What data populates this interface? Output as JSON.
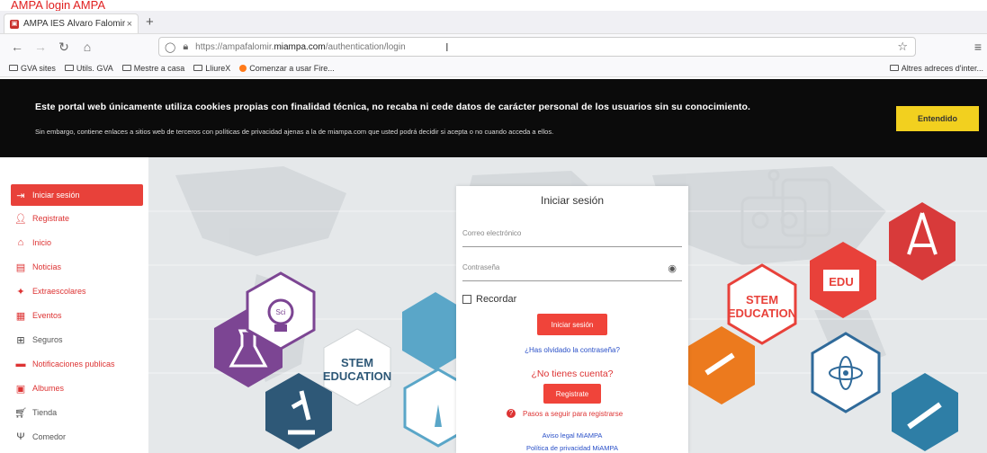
{
  "note": "AMPA login AMPA",
  "browser": {
    "tab_title": "AMPA IES Álvaro Falomir",
    "tab_close": "×",
    "new_tab": "+",
    "url_prefix": "https://ampafalomir.",
    "url_host": "miampa.com",
    "url_path": "/authentication/login",
    "bookmarks": [
      "GVA sites",
      "Utils. GVA",
      "Mestre a casa",
      "LliureX",
      "Comenzar a usar Fire..."
    ],
    "bookmarks_right": "Altres adreces d'inter..."
  },
  "cookie": {
    "title": "Este portal web únicamente utiliza cookies propias con finalidad técnica, no recaba ni cede datos de carácter personal de los usuarios sin su conocimiento.",
    "subtitle": "Sin embargo, contiene enlaces a sitios web de terceros con políticas de privacidad ajenas a la de miampa.com que usted podrá decidir si acepta o no cuando acceda a ellos.",
    "button": "Entendido",
    "button_color": "#f2d01f"
  },
  "sidebar": {
    "items": [
      {
        "label": "Iniciar sesión",
        "icon": "login-icon"
      },
      {
        "label": "Registrate",
        "icon": "add-user-icon"
      },
      {
        "label": "Inicio",
        "icon": "home-icon"
      },
      {
        "label": "Noticias",
        "icon": "news-icon"
      },
      {
        "label": "Extraescolares",
        "icon": "running-icon"
      },
      {
        "label": "Eventos",
        "icon": "calendar-icon"
      },
      {
        "label": "Seguros",
        "icon": "plus-box-icon"
      },
      {
        "label": "Notificaciones publicas",
        "icon": "message-icon"
      },
      {
        "label": "Albumes",
        "icon": "image-icon"
      },
      {
        "label": "Tienda",
        "icon": "cart-icon"
      },
      {
        "label": "Comedor",
        "icon": "cutlery-icon"
      }
    ],
    "active_color": "#e8413a"
  },
  "hero": {
    "stem_left_1": "STEM",
    "stem_left_2": "EDUCATION",
    "stem_right_1": "STEM",
    "stem_right_2": "EDUCATION",
    "edu": "EDU",
    "sci": "Sci"
  },
  "login": {
    "title": "Iniciar sesión",
    "email_label": "Correo electrónico",
    "password_label": "Contraseña",
    "remember": "Recordar",
    "submit": "Iniciar sesión",
    "forgot": "¿Has olvidado la contraseña?",
    "no_account": "¿No tienes cuenta?",
    "register": "Registrate",
    "steps": "Pasos a seguir para registrarse",
    "legal": "Aviso legal MiAMPA",
    "privacy": "Política de privacidad MiAMPA"
  }
}
